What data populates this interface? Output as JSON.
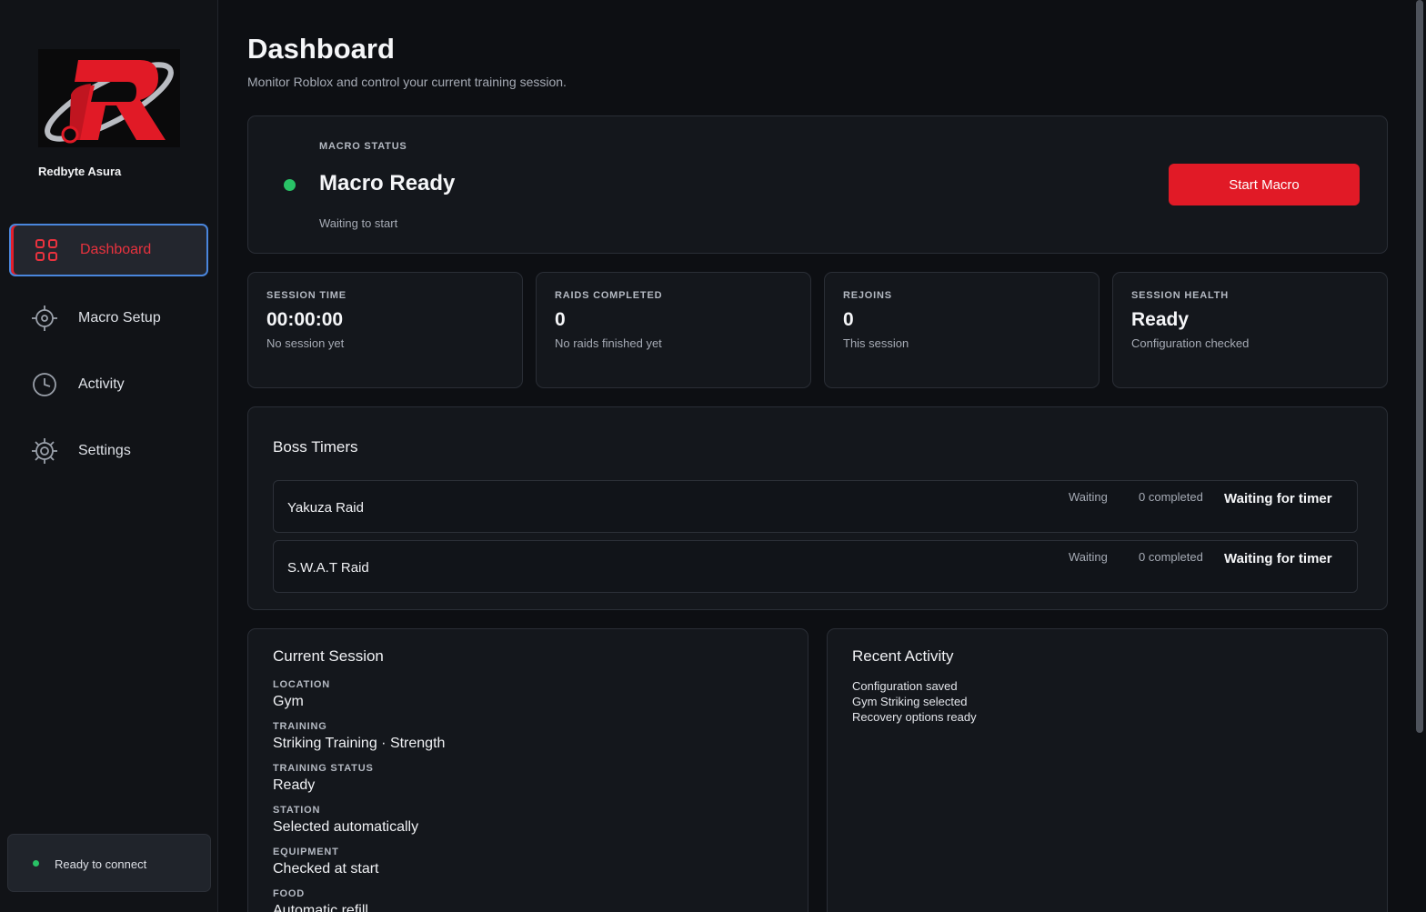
{
  "brand": {
    "name": "Redbyte Asura"
  },
  "nav": {
    "dashboard": {
      "label": "Dashboard",
      "icon": "grid-icon"
    },
    "macro_setup": {
      "label": "Macro Setup",
      "icon": "crosshair-icon"
    },
    "activity": {
      "label": "Activity",
      "icon": "clock-icon"
    },
    "settings": {
      "label": "Settings",
      "icon": "gear-icon"
    }
  },
  "connection": {
    "text": "Ready to connect",
    "color": "#29c266"
  },
  "header": {
    "title": "Dashboard",
    "subtitle": "Monitor Roblox and control your current training session."
  },
  "macro": {
    "eyebrow": "MACRO STATUS",
    "title": "Macro Ready",
    "subtitle": "Waiting to start",
    "button": "Start Macro",
    "status_color": "#29c266",
    "accent": "#e11a26"
  },
  "stats": [
    {
      "label": "SESSION TIME",
      "value": "00:00:00",
      "desc": "No session yet"
    },
    {
      "label": "RAIDS COMPLETED",
      "value": "0",
      "desc": "No raids finished yet"
    },
    {
      "label": "REJOINS",
      "value": "0",
      "desc": "This session"
    },
    {
      "label": "SESSION HEALTH",
      "value": "Ready",
      "desc": "Configuration checked"
    }
  ],
  "boss_timers": {
    "title": "Boss Timers",
    "rows": [
      {
        "name": "Yakuza Raid",
        "state": "Waiting",
        "count": "0 completed",
        "timer": "Waiting for timer"
      },
      {
        "name": "S.W.A.T Raid",
        "state": "Waiting",
        "count": "0 completed",
        "timer": "Waiting for timer"
      }
    ]
  },
  "current_session": {
    "title": "Current Session",
    "fields": [
      {
        "label": "LOCATION",
        "value": "Gym"
      },
      {
        "label": "TRAINING",
        "value": "Striking Training · Strength"
      },
      {
        "label": "TRAINING STATUS",
        "value": "Ready"
      },
      {
        "label": "STATION",
        "value": "Selected automatically"
      },
      {
        "label": "EQUIPMENT",
        "value": "Checked at start"
      },
      {
        "label": "FOOD",
        "value": "Automatic refill"
      }
    ]
  },
  "recent_activity": {
    "title": "Recent Activity",
    "items": [
      "Configuration saved",
      "Gym Striking selected",
      "Recovery options ready"
    ]
  }
}
